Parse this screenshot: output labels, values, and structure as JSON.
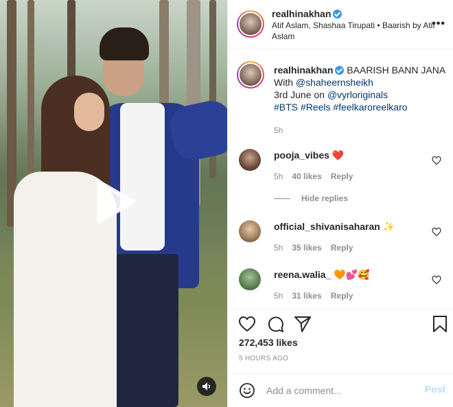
{
  "header": {
    "username": "realhinakhan",
    "subtitle": "Atif Aslam, Shashaa Tirupati • Baarish by Atif Aslam",
    "more": "•••"
  },
  "caption": {
    "username": "realhinakhan",
    "title": "BAARISH BANN JANA",
    "line2_prefix": "With ",
    "mention1": "@shaheernsheikh",
    "line3_prefix": "3rd June on ",
    "mention2": "@vyrloriginals",
    "hashtags": "#BTS #Reels #feelkaroreelkaro",
    "time": "5h"
  },
  "comments": [
    {
      "username": "pooja_vibes",
      "text": "❤️",
      "time": "5h",
      "likes": "40 likes",
      "reply": "Reply"
    },
    {
      "username": "official_shivanisaharan",
      "text": "✨",
      "time": "5h",
      "likes": "35 likes",
      "reply": "Reply"
    },
    {
      "username": "reena.walia_",
      "text": "🧡💕🥰",
      "time": "5h",
      "likes": "31 likes",
      "reply": "Reply"
    }
  ],
  "hide_replies": "Hide replies",
  "post": {
    "likes": "272,453 likes",
    "ago": "5 HOURS AGO"
  },
  "add_comment": {
    "placeholder": "Add a comment...",
    "post_label": "Post"
  },
  "colors": {
    "link": "#00376b",
    "verified": "#3897f0",
    "post_disabled": "#b2dffc",
    "jacket": "#263a8c"
  },
  "icons": [
    "play-icon",
    "volume-off-icon",
    "heart-icon",
    "comment-icon",
    "share-icon",
    "bookmark-icon",
    "emoji-icon",
    "more-icon",
    "verified-icon"
  ]
}
